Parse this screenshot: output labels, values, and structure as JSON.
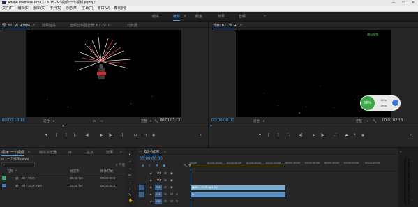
{
  "app": {
    "title": "Adobe Premiere Pro CC 2015 - F:\\视频\\一个视频.prproj *"
  },
  "menu": [
    "文件(F)",
    "编辑(E)",
    "剪辑(C)",
    "序列(S)",
    "标记(M)",
    "字幕(T)",
    "窗口(W)",
    "帮助(H)"
  ],
  "workspace_tabs": [
    {
      "label": "组件",
      "active": false
    },
    {
      "label": "编辑",
      "active": true
    },
    {
      "label": "颜色",
      "active": false
    },
    {
      "label": "效果",
      "active": false
    },
    {
      "label": "音频",
      "active": false
    }
  ],
  "workspace_more": "»",
  "source_monitor": {
    "tabs": [
      "源: BJ - VCR.mp4",
      "效果控件",
      "音频剪辑混合器: BJ - VCR",
      "元数据"
    ],
    "active_tab": 0,
    "timecode": "00:00:19:18",
    "fit": "适合",
    "duration": "00:01:02:13",
    "quality": "完整"
  },
  "program_monitor": {
    "title": "节目: BJ - VCR",
    "timecode": "00:00:00:00",
    "fit": "适合",
    "quality": "完整",
    "duration": "00:01:02:13",
    "watermark": "腾讯视频",
    "overlay_percent": "96%",
    "overlay_down": "0K/s",
    "overlay_up": "0K/s"
  },
  "project_panel": {
    "tabs": [
      "项目: 一个视频",
      "媒体浏览器",
      "库",
      "信息",
      "效果"
    ],
    "active_tab": 0,
    "project_file": "一个视频.prproj",
    "item_count": "2 个项",
    "columns": [
      "名称",
      "帧速率",
      "媒体开始"
    ],
    "items": [
      {
        "name": "BJ - VCR",
        "fps": "25.00 fps",
        "start": "00:00:00:0",
        "color": "#2fb36b"
      },
      {
        "name": "BJ - VCR.mp4",
        "fps": "25.00 fps",
        "start": "00:00:00:0",
        "color": "#4a7ad0"
      }
    ]
  },
  "timeline": {
    "sequence_name": "BJ - VCR",
    "timecode": "00:00:00:00",
    "ruler": [
      ":00:00",
      "00:00:15:00",
      "00:00:30:00",
      "00:00:45:00",
      "00:01:00:00",
      "00:01:15:00",
      "00:01:30:00",
      "00:01:45:00",
      "00:02:00:00",
      "00:02:15:00"
    ],
    "tracks": [
      {
        "label": "V3"
      },
      {
        "label": "V2"
      },
      {
        "label": "V1"
      },
      {
        "label": "A1"
      },
      {
        "label": "A2"
      }
    ],
    "video_clip": "BJ - VCR.mp4 [V]",
    "audio_clip": "fx"
  },
  "tools": [
    "▸",
    "⇔",
    "↔",
    "✂",
    "→",
    "↕",
    "✎",
    "✋",
    "Q"
  ],
  "colors": {
    "accent": "#4a9ef0",
    "clip_video": "#7aaccf",
    "clip_audio": "#5a93c5",
    "overlay_green": "#3aa845"
  }
}
